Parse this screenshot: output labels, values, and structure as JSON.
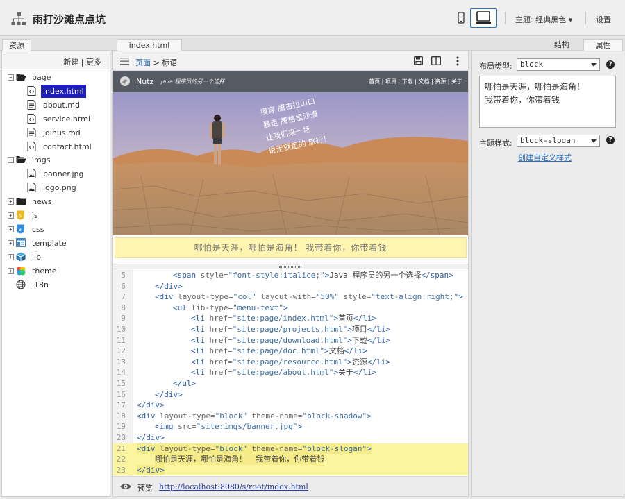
{
  "header": {
    "title": "雨打沙滩点点坑",
    "theme_label": "主题: 经典黑色 ▾",
    "settings_label": "设置"
  },
  "tabs": {
    "resources": "资源",
    "file": "index.html",
    "structure": "结构",
    "properties": "属性"
  },
  "left": {
    "actions": "新建 | 更多",
    "tree": [
      {
        "label": "page",
        "kind": "folder-open",
        "toggle": "−"
      },
      {
        "label": "index.html",
        "kind": "html",
        "selected": true
      },
      {
        "label": "about.md",
        "kind": "file"
      },
      {
        "label": "service.html",
        "kind": "html"
      },
      {
        "label": "joinus.md",
        "kind": "file"
      },
      {
        "label": "contact.html",
        "kind": "html"
      },
      {
        "label": "imgs",
        "kind": "folder-open",
        "toggle": "−"
      },
      {
        "label": "banner.jpg",
        "kind": "image"
      },
      {
        "label": "logo.png",
        "kind": "image"
      },
      {
        "label": "news",
        "kind": "folder",
        "toggle": "+"
      },
      {
        "label": "js",
        "kind": "js",
        "toggle": "+"
      },
      {
        "label": "css",
        "kind": "css",
        "toggle": "+"
      },
      {
        "label": "template",
        "kind": "template",
        "toggle": "+"
      },
      {
        "label": "lib",
        "kind": "lib",
        "toggle": "+"
      },
      {
        "label": "theme",
        "kind": "theme",
        "toggle": "+"
      },
      {
        "label": "i18n",
        "kind": "globe"
      }
    ]
  },
  "center": {
    "breadcrumb_link": "页面",
    "breadcrumb_sep": ">",
    "breadcrumb_current": "标语",
    "site": {
      "brand": "Nutz",
      "tagline": "Java 程序员的另一个选择",
      "menu": "首页 | 项目 | 下载 | 文档 | 资源 | 关于",
      "hero_poem": [
        "摸穿 唐古拉山口",
        "暴走 腾格里沙漠",
        "让我们来一场",
        "说走就走的 旅行！"
      ]
    },
    "slogan": "哪怕是天涯，哪怕是海角！ 我带着你，你带着钱",
    "code_lines": [
      {
        "n": "5",
        "indent": 3,
        "html": "<span class='tag'>&lt;span</span> <span class='attr'>style=</span><span class='str'>\"font-style:italice;\"</span><span class='tag'>&gt;</span>Java 程序员的另一个选择<span class='tag'>&lt;/span&gt;</span>"
      },
      {
        "n": "6",
        "indent": 2,
        "html": "<span class='tag'>&lt;/div&gt;</span>"
      },
      {
        "n": "7",
        "indent": 2,
        "html": "<span class='tag'>&lt;div</span> <span class='attr'>layout-type=</span><span class='str'>\"col\"</span> <span class='attr'>layout-with=</span><span class='str'>\"50%\"</span> <span class='attr'>style=</span><span class='str'>\"text-align:right;\"</span><span class='tag'>&gt;</span>"
      },
      {
        "n": "8",
        "indent": 3,
        "html": "<span class='tag'>&lt;ul</span> <span class='attr'>lib-type=</span><span class='str'>\"menu-text\"</span><span class='tag'>&gt;</span>"
      },
      {
        "n": "9",
        "indent": 4,
        "html": "<span class='tag'>&lt;li</span> <span class='attr'>href=</span><span class='str'>\"site:page/index.html\"</span><span class='tag'>&gt;</span>首页<span class='tag'>&lt;/li&gt;</span>"
      },
      {
        "n": "10",
        "indent": 4,
        "html": "<span class='tag'>&lt;li</span> <span class='attr'>href=</span><span class='str'>\"site:page/projects.html\"</span><span class='tag'>&gt;</span>项目<span class='tag'>&lt;/li&gt;</span>"
      },
      {
        "n": "11",
        "indent": 4,
        "html": "<span class='tag'>&lt;li</span> <span class='attr'>href=</span><span class='str'>\"site:page/download.html\"</span><span class='tag'>&gt;</span>下载<span class='tag'>&lt;/li&gt;</span>"
      },
      {
        "n": "12",
        "indent": 4,
        "html": "<span class='tag'>&lt;li</span> <span class='attr'>href=</span><span class='str'>\"site:page/doc.html\"</span><span class='tag'>&gt;</span>文档<span class='tag'>&lt;/li&gt;</span>"
      },
      {
        "n": "13",
        "indent": 4,
        "html": "<span class='tag'>&lt;li</span> <span class='attr'>href=</span><span class='str'>\"site:page/resource.html\"</span><span class='tag'>&gt;</span>资源<span class='tag'>&lt;/li&gt;</span>"
      },
      {
        "n": "14",
        "indent": 4,
        "html": "<span class='tag'>&lt;li</span> <span class='attr'>href=</span><span class='str'>\"site:page/about.html\"</span><span class='tag'>&gt;</span>关于<span class='tag'>&lt;/li&gt;</span>"
      },
      {
        "n": "15",
        "indent": 3,
        "html": "<span class='tag'>&lt;/ul&gt;</span>"
      },
      {
        "n": "16",
        "indent": 2,
        "html": "<span class='tag'>&lt;/div&gt;</span>"
      },
      {
        "n": "17",
        "indent": 1,
        "html": "<span class='tag'>&lt;/div&gt;</span>"
      },
      {
        "n": "18",
        "indent": 1,
        "html": "<span class='tag'>&lt;div</span> <span class='attr'>layout-type=</span><span class='str'>\"block\"</span> <span class='attr'>theme-name=</span><span class='str'>\"block-shadow\"</span><span class='tag'>&gt;</span>"
      },
      {
        "n": "19",
        "indent": 2,
        "html": "<span class='tag'>&lt;img</span> <span class='attr'>src=</span><span class='str'>\"site:imgs/banner.jpg\"</span><span class='tag'>&gt;</span>"
      },
      {
        "n": "20",
        "indent": 1,
        "html": "<span class='tag'>&lt;/div&gt;</span>"
      },
      {
        "n": "21",
        "indent": 1,
        "hl": true,
        "html": "<span class='tag'>&lt;div</span> <span class='attr'>layout-type=</span><span class='str'>\"block\"</span> <span class='attr'>theme-name=</span><span class='str'>\"block-slogan\"</span><span class='tag'>&gt;</span>"
      },
      {
        "n": "22",
        "indent": 2,
        "hl": true,
        "html": "哪怕是天涯，哪怕是海角！  我带着你，你带着钱"
      },
      {
        "n": "23",
        "indent": 1,
        "hl": true,
        "html": "<span class='tag'>&lt;/div&gt;</span>"
      }
    ],
    "preview_label": "预览",
    "preview_url": "http://localhost:8080/s/root/index.html"
  },
  "right": {
    "layout_type_label": "布局类型:",
    "layout_type_value": "block",
    "slogan_text": "哪怕是天涯，哪怕是海角！\n我带着你，你带着钱",
    "theme_style_label": "主题样式:",
    "theme_style_value": "block-slogan",
    "custom_style_link": "创建自定义样式"
  }
}
